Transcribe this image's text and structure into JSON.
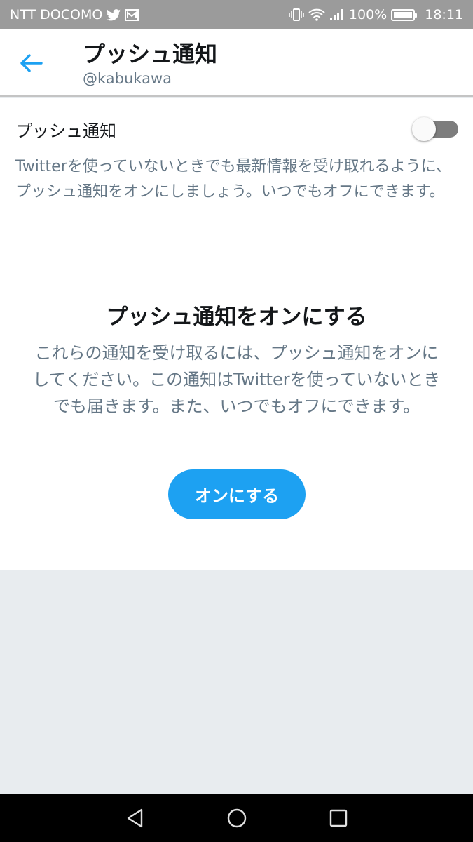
{
  "status_bar": {
    "carrier": "NTT DOCOMO",
    "battery": "100%",
    "time": "18:11"
  },
  "header": {
    "title": "プッシュ通知",
    "handle": "@kabukawa"
  },
  "settings": {
    "toggle_label": "プッシュ通知",
    "toggle_on": false,
    "description": "Twitterを使っていないときでも最新情報を受け取れるように、プッシュ通知をオンにしましょう。いつでもオフにできます。"
  },
  "prompt": {
    "title": "プッシュ通知をオンにする",
    "body": "これらの通知を受け取るには、プッシュ通知をオンにしてください。この通知はTwitterを使っていないときでも届きます。また、いつでもオフにできます。",
    "button_label": "オンにする"
  },
  "colors": {
    "accent": "#1da1f2",
    "status_bar": "#9b9b9b",
    "background": "#e8ecef"
  }
}
